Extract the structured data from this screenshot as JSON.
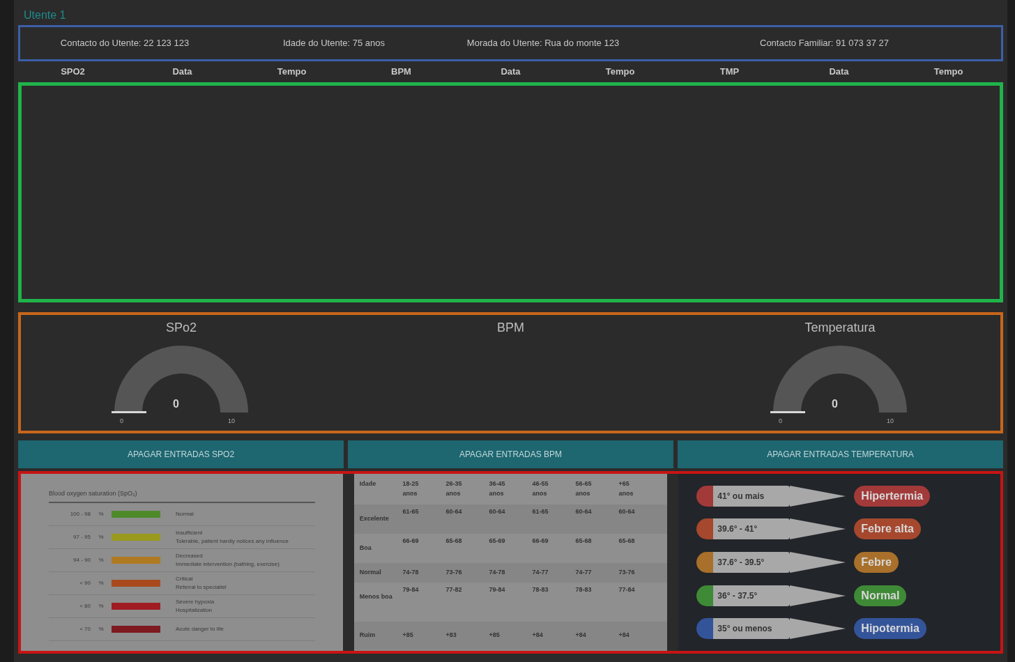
{
  "title": "Utente 1",
  "info": [
    "Contacto do Utente: 22 123 123",
    "Idade do Utente: 75 anos",
    "Morada do Utente: Rua do monte 123",
    "Contacto Familiar: 91 073 37 27"
  ],
  "table": {
    "columns": [
      "SPO2",
      "Data",
      "Tempo",
      "BPM",
      "Data",
      "Tempo",
      "TMP",
      "Data",
      "Tempo"
    ]
  },
  "gauges": [
    {
      "kind": "gauge",
      "title": "SPo2",
      "value": "0",
      "min": "0",
      "max": "10"
    },
    {
      "kind": "empty",
      "title": "BPM"
    },
    {
      "kind": "gauge",
      "title": "Temperatura",
      "value": "0",
      "min": "0",
      "max": "10"
    }
  ],
  "buttons": [
    "APAGAR ENTRADAS SPO2",
    "APAGAR ENTRADAS BPM",
    "APAGAR ENTRADAS TEMPERATURA"
  ],
  "spo2_chart": {
    "title": "Blood oxygen saturation (SpO₂)",
    "rows": [
      {
        "range": "100 - 98",
        "unit": "%",
        "color": "#4e8a2a",
        "label": "Normal"
      },
      {
        "range": "97 - 95",
        "unit": "%",
        "color": "#9a9a1e",
        "label": "Insufficient",
        "note": "Tolerable, patient hardly notices any influence"
      },
      {
        "range": "94 - 90",
        "unit": "%",
        "color": "#b07a22",
        "label": "Decreased",
        "note": "Immediate intervention (bathing, exercise)"
      },
      {
        "range": "< 90",
        "unit": "%",
        "color": "#a84a1e",
        "label": "Critical",
        "note": "Referral to specialist"
      },
      {
        "range": "< 80",
        "unit": "%",
        "color": "#a01c22",
        "label": "Severe hypoxia",
        "note": "Hospitalization"
      },
      {
        "range": "< 70",
        "unit": "%",
        "color": "#7e1a20",
        "label": "Acute danger to life"
      }
    ]
  },
  "bpm_table": {
    "header": [
      "Idade",
      "18-25 anos",
      "26-35 anos",
      "36-45 anos",
      "46-55 anos",
      "56-65 anos",
      "+65 anos"
    ],
    "rows": [
      [
        "Excelente",
        "61-65",
        "60-64",
        "60-64",
        "61-65",
        "60-64",
        "60-64"
      ],
      [
        "Boa",
        "66-69",
        "65-68",
        "65-69",
        "66-69",
        "65-68",
        "65-68"
      ],
      [
        "Normal",
        "74-78",
        "73-76",
        "74-78",
        "74-77",
        "74-77",
        "73-76"
      ],
      [
        "Menos boa",
        "79-84",
        "77-82",
        "79-84",
        "78-83",
        "78-83",
        "77-84"
      ],
      [
        "Ruim",
        "+85",
        "+83",
        "+85",
        "+84",
        "+84",
        "+84"
      ]
    ]
  },
  "temperature_chart": [
    {
      "range": "41° ou mais",
      "label": "Hipertermia",
      "color": "#a33a3a"
    },
    {
      "range": "39.6° - 41°",
      "label": "Febre alta",
      "color": "#a5482e"
    },
    {
      "range": "37.6° - 39.5°",
      "label": "Febre",
      "color": "#a8702a"
    },
    {
      "range": "36° - 37.5°",
      "label": "Normal",
      "color": "#3f8a36"
    },
    {
      "range": "35° ou menos",
      "label": "Hipotermia",
      "color": "#34549a"
    }
  ]
}
